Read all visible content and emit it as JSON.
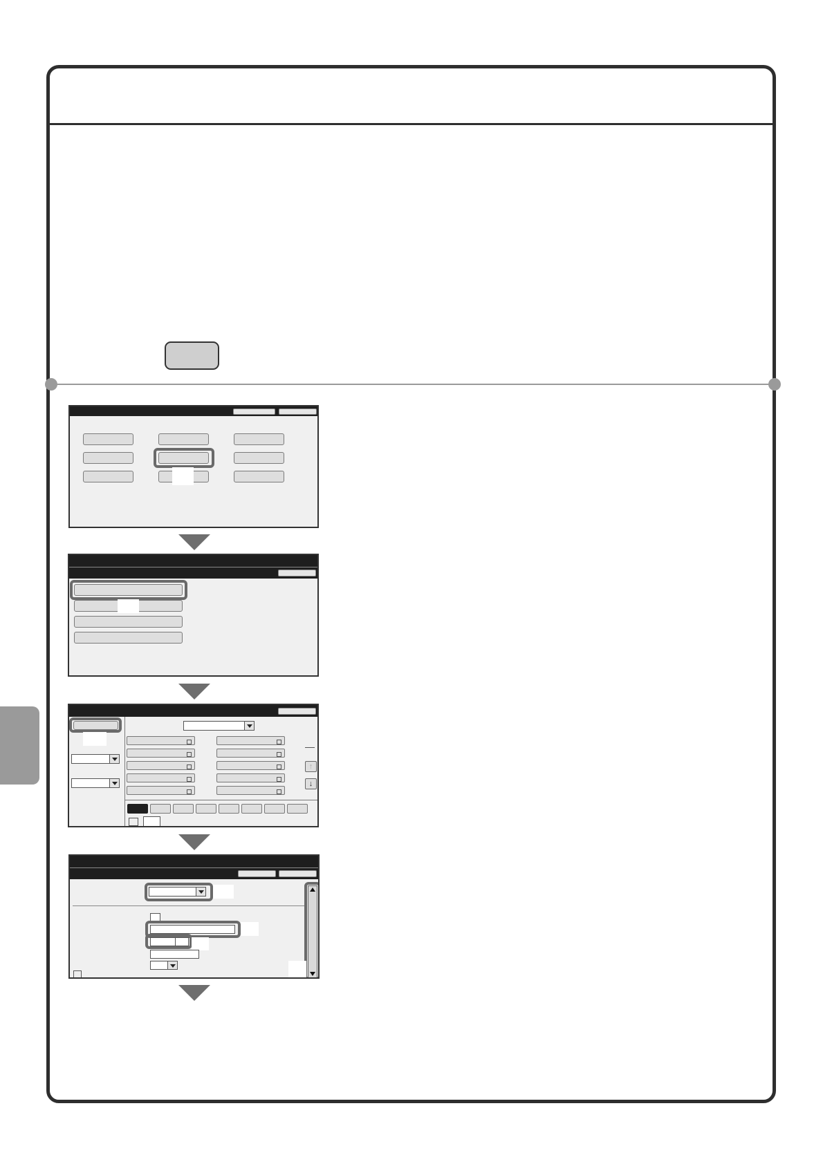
{
  "page": {
    "section_tab": "",
    "header_title": ""
  },
  "icons": {
    "side_tab": "section-thumb-tab",
    "key": "panel-key",
    "down_arrow": "step-arrow-down"
  },
  "colors": {
    "frame": "#2e2e2e",
    "rule": "#9a9a9a",
    "key_fill": "#cfcfcf",
    "highlight": "#6a6a6a",
    "screen_bar": "#1e1e1e"
  }
}
